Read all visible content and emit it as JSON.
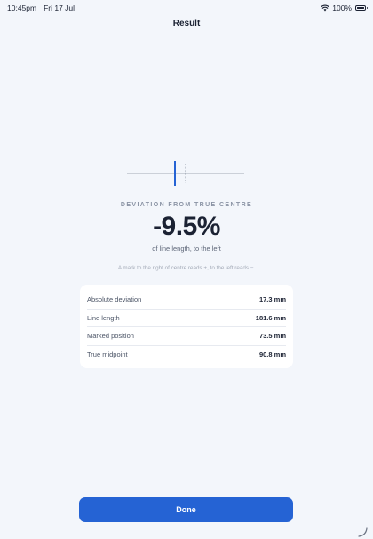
{
  "status_bar": {
    "time": "10:45pm",
    "date": "Fri 17 Jul",
    "battery": "100%"
  },
  "nav": {
    "title": "Result"
  },
  "result": {
    "overline": "DEVIATION FROM TRUE CENTRE",
    "value": "-9.5%",
    "subtext": "of line length, to the left",
    "hint": "A mark to the right of centre reads +, to the left reads −."
  },
  "stats": [
    {
      "label": "Absolute deviation",
      "value": "17.3 mm"
    },
    {
      "label": "Line length",
      "value": "181.6 mm"
    },
    {
      "label": "Marked position",
      "value": "73.5 mm"
    },
    {
      "label": "True midpoint",
      "value": "90.8 mm"
    }
  ],
  "actions": {
    "done_label": "Done"
  },
  "colors": {
    "accent": "#2563d4",
    "background": "#f3f6fb",
    "card": "#ffffff"
  }
}
